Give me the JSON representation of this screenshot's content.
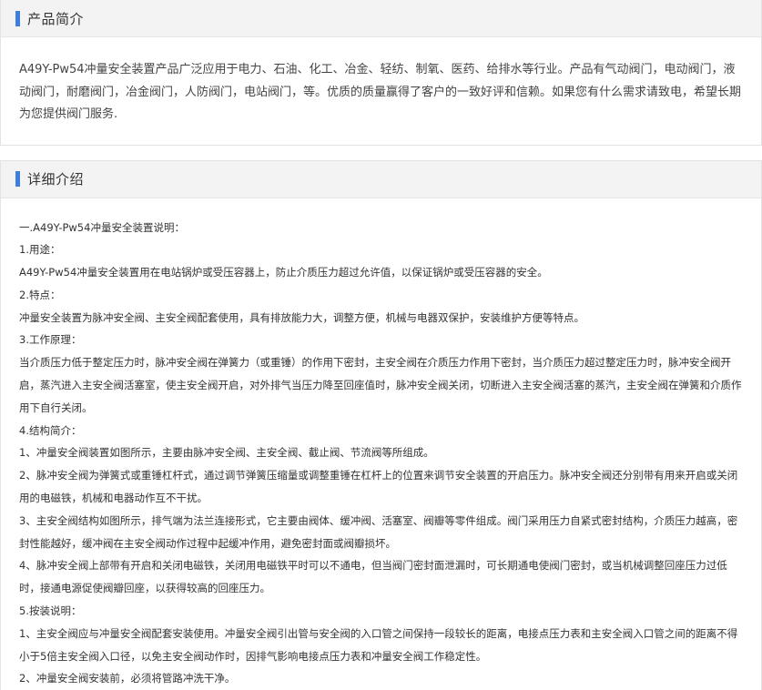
{
  "intro": {
    "title": "产品简介",
    "text": "A49Y-Pw54冲量安全装置产品广泛应用于电力、石油、化工、冶金、轻纺、制氧、医药、给排水等行业。产品有气动阀门，电动阀门，液动阀门，耐磨阀门，冶金阀门，人防阀门，电站阀门，等。优质的质量赢得了客户的一致好评和信赖。如果您有什么需求请致电，希望长期为您提供阀门服务."
  },
  "detail": {
    "title": "详细介绍",
    "paragraphs": [
      "一.A49Y-Pw54冲量安全装置说明：",
      "1.用途：",
      "A49Y-Pw54冲量安全装置用在电站锅炉或受压容器上，防止介质压力超过允许值，以保证锅炉或受压容器的安全。",
      "2.特点：",
      "冲量安全装置为脉冲安全阀、主安全阀配套使用，具有排放能力大，调整方便，机械与电器双保护，安装维护方便等特点。",
      "3.工作原理：",
      "当介质压力低于整定压力时，脉冲安全阀在弹簧力（或重锤）的作用下密封，主安全阀在介质压力作用下密封，当介质压力超过整定压力时，脉冲安全阀开启，蒸汽进入主安全阀活塞室，使主安全阀开启，对外排气当压力降至回座值时，脉冲安全阀关闭，切断进入主安全阀活塞的蒸汽，主安全阀在弹簧和介质作用下自行关闭。",
      "4.结构简介：",
      "1、冲量安全阀装置如图所示，主要由脉冲安全阀、主安全阀、截止阀、节流阀等所组成。",
      "2、脉冲安全阀为弹簧式或重锤杠杆式，通过调节弹簧压缩量或调整重锤在杠杆上的位置来调节安全装置的开启压力。脉冲安全阀还分别带有用来开启或关闭用的电磁铁，机械和电器动作互不干扰。",
      "3、主安全阀结构如图所示，排气端为法兰连接形式，它主要由阀体、缓冲阀、活塞室、阀瓣等零件组成。阀门采用压力自紧式密封结构，介质压力越高，密封性能越好，缓冲阀在主安全阀动作过程中起缓冲作用，避免密封面或阀瓣损坏。",
      "4、脉冲安全阀上部带有开启和关闭电磁铁，关闭用电磁铁平时可以不通电，但当阀门密封面泄漏时，可长期通电使阀门密封，或当机械调整回座压力过低时，接通电源促使阀瓣回座，以获得较高的回座压力。",
      "5.按装说明：",
      "1、主安全阀应与冲量安全阀配套安装使用。冲量安全阀引出管与安全阀的入口管之间保持一段较长的距离，电接点压力表和主安全阀入口管之间的距离不得小于5倍主安全阀入口径，以免主安全阀动作时，因排气影响电接点压力表和冲量安全阀工作稳定性。",
      "2、冲量安全阀安装前，必须将管路冲洗干净。"
    ]
  },
  "colors": {
    "accent": "#3f7fd9",
    "header_bg": "#f3f3f3"
  }
}
